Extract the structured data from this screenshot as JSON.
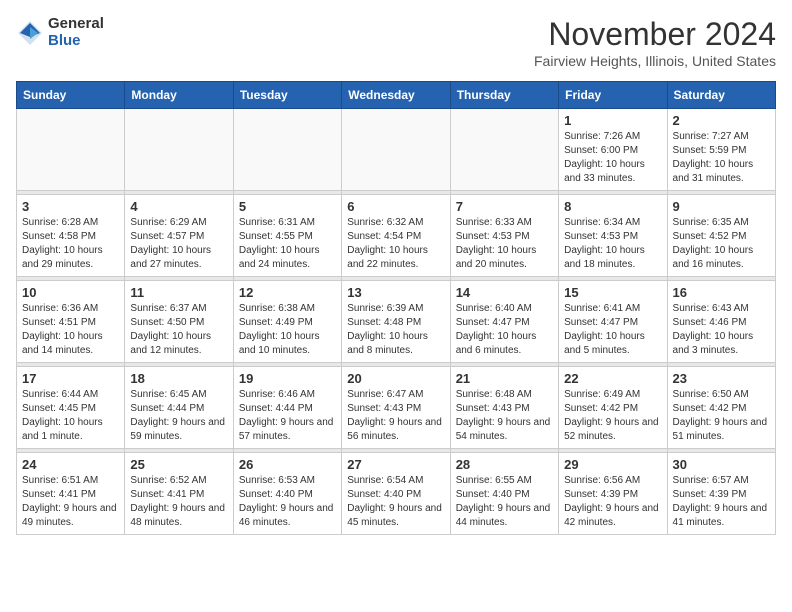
{
  "logo": {
    "general": "General",
    "blue": "Blue"
  },
  "title": "November 2024",
  "location": "Fairview Heights, Illinois, United States",
  "days_header": [
    "Sunday",
    "Monday",
    "Tuesday",
    "Wednesday",
    "Thursday",
    "Friday",
    "Saturday"
  ],
  "weeks": [
    [
      {
        "day": "",
        "detail": ""
      },
      {
        "day": "",
        "detail": ""
      },
      {
        "day": "",
        "detail": ""
      },
      {
        "day": "",
        "detail": ""
      },
      {
        "day": "",
        "detail": ""
      },
      {
        "day": "1",
        "detail": "Sunrise: 7:26 AM\nSunset: 6:00 PM\nDaylight: 10 hours\nand 33 minutes."
      },
      {
        "day": "2",
        "detail": "Sunrise: 7:27 AM\nSunset: 5:59 PM\nDaylight: 10 hours\nand 31 minutes."
      }
    ],
    [
      {
        "day": "3",
        "detail": "Sunrise: 6:28 AM\nSunset: 4:58 PM\nDaylight: 10 hours\nand 29 minutes."
      },
      {
        "day": "4",
        "detail": "Sunrise: 6:29 AM\nSunset: 4:57 PM\nDaylight: 10 hours\nand 27 minutes."
      },
      {
        "day": "5",
        "detail": "Sunrise: 6:31 AM\nSunset: 4:55 PM\nDaylight: 10 hours\nand 24 minutes."
      },
      {
        "day": "6",
        "detail": "Sunrise: 6:32 AM\nSunset: 4:54 PM\nDaylight: 10 hours\nand 22 minutes."
      },
      {
        "day": "7",
        "detail": "Sunrise: 6:33 AM\nSunset: 4:53 PM\nDaylight: 10 hours\nand 20 minutes."
      },
      {
        "day": "8",
        "detail": "Sunrise: 6:34 AM\nSunset: 4:53 PM\nDaylight: 10 hours\nand 18 minutes."
      },
      {
        "day": "9",
        "detail": "Sunrise: 6:35 AM\nSunset: 4:52 PM\nDaylight: 10 hours\nand 16 minutes."
      }
    ],
    [
      {
        "day": "10",
        "detail": "Sunrise: 6:36 AM\nSunset: 4:51 PM\nDaylight: 10 hours\nand 14 minutes."
      },
      {
        "day": "11",
        "detail": "Sunrise: 6:37 AM\nSunset: 4:50 PM\nDaylight: 10 hours\nand 12 minutes."
      },
      {
        "day": "12",
        "detail": "Sunrise: 6:38 AM\nSunset: 4:49 PM\nDaylight: 10 hours\nand 10 minutes."
      },
      {
        "day": "13",
        "detail": "Sunrise: 6:39 AM\nSunset: 4:48 PM\nDaylight: 10 hours\nand 8 minutes."
      },
      {
        "day": "14",
        "detail": "Sunrise: 6:40 AM\nSunset: 4:47 PM\nDaylight: 10 hours\nand 6 minutes."
      },
      {
        "day": "15",
        "detail": "Sunrise: 6:41 AM\nSunset: 4:47 PM\nDaylight: 10 hours\nand 5 minutes."
      },
      {
        "day": "16",
        "detail": "Sunrise: 6:43 AM\nSunset: 4:46 PM\nDaylight: 10 hours\nand 3 minutes."
      }
    ],
    [
      {
        "day": "17",
        "detail": "Sunrise: 6:44 AM\nSunset: 4:45 PM\nDaylight: 10 hours\nand 1 minute."
      },
      {
        "day": "18",
        "detail": "Sunrise: 6:45 AM\nSunset: 4:44 PM\nDaylight: 9 hours\nand 59 minutes."
      },
      {
        "day": "19",
        "detail": "Sunrise: 6:46 AM\nSunset: 4:44 PM\nDaylight: 9 hours\nand 57 minutes."
      },
      {
        "day": "20",
        "detail": "Sunrise: 6:47 AM\nSunset: 4:43 PM\nDaylight: 9 hours\nand 56 minutes."
      },
      {
        "day": "21",
        "detail": "Sunrise: 6:48 AM\nSunset: 4:43 PM\nDaylight: 9 hours\nand 54 minutes."
      },
      {
        "day": "22",
        "detail": "Sunrise: 6:49 AM\nSunset: 4:42 PM\nDaylight: 9 hours\nand 52 minutes."
      },
      {
        "day": "23",
        "detail": "Sunrise: 6:50 AM\nSunset: 4:42 PM\nDaylight: 9 hours\nand 51 minutes."
      }
    ],
    [
      {
        "day": "24",
        "detail": "Sunrise: 6:51 AM\nSunset: 4:41 PM\nDaylight: 9 hours\nand 49 minutes."
      },
      {
        "day": "25",
        "detail": "Sunrise: 6:52 AM\nSunset: 4:41 PM\nDaylight: 9 hours\nand 48 minutes."
      },
      {
        "day": "26",
        "detail": "Sunrise: 6:53 AM\nSunset: 4:40 PM\nDaylight: 9 hours\nand 46 minutes."
      },
      {
        "day": "27",
        "detail": "Sunrise: 6:54 AM\nSunset: 4:40 PM\nDaylight: 9 hours\nand 45 minutes."
      },
      {
        "day": "28",
        "detail": "Sunrise: 6:55 AM\nSunset: 4:40 PM\nDaylight: 9 hours\nand 44 minutes."
      },
      {
        "day": "29",
        "detail": "Sunrise: 6:56 AM\nSunset: 4:39 PM\nDaylight: 9 hours\nand 42 minutes."
      },
      {
        "day": "30",
        "detail": "Sunrise: 6:57 AM\nSunset: 4:39 PM\nDaylight: 9 hours\nand 41 minutes."
      }
    ]
  ]
}
